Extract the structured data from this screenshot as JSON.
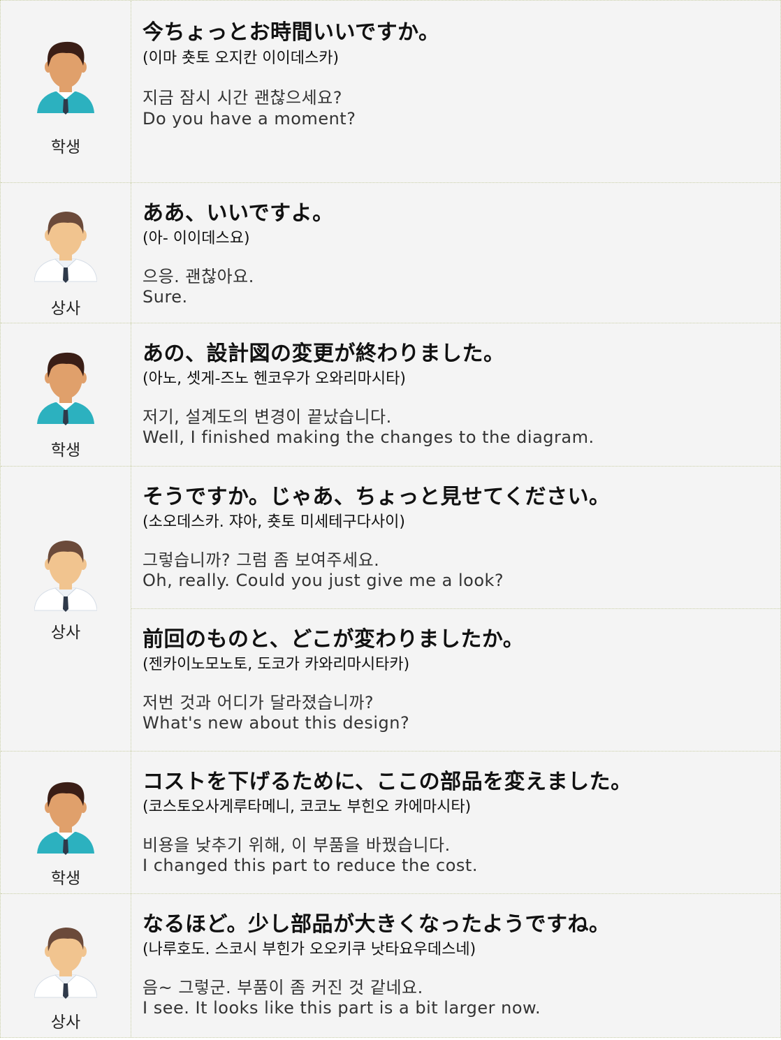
{
  "colors": {
    "background": "#f4f4f4",
    "border": "#c9cfa6",
    "student_shirt": "#2cb1bf",
    "boss_shirt": "#ffffff",
    "skin_student": "#e0a06b",
    "skin_boss": "#f1c48f"
  },
  "rows": [
    {
      "speaker": {
        "role": "학생",
        "icon": "student-avatar-icon"
      },
      "lines": [
        {
          "jp": "今ちょっとお時間いいですか。",
          "reading": "(이마 춋토 오지칸 이이데스카)",
          "ko": "지금 잠시 시간 괜찮으세요?",
          "en": "Do you have a moment?"
        }
      ]
    },
    {
      "speaker": {
        "role": "상사",
        "icon": "boss-avatar-icon"
      },
      "lines": [
        {
          "jp": "ああ、いいですよ。",
          "reading": "(아- 이이데스요)",
          "ko": "으응. 괜찮아요.",
          "en": "Sure."
        }
      ]
    },
    {
      "speaker": {
        "role": "학생",
        "icon": "student-avatar-icon"
      },
      "lines": [
        {
          "jp": "あの、設計図の変更が終わりました。",
          "reading": "(아노, 셋게-즈노 헨코우가 오와리마시타)",
          "ko": "저기, 설계도의 변경이 끝났습니다.",
          "en": "Well, I finished making the changes to the diagram."
        }
      ]
    },
    {
      "speaker": {
        "role": "상사",
        "icon": "boss-avatar-icon"
      },
      "lines": [
        {
          "jp": "そうですか。じゃあ、ちょっと見せてください。",
          "reading": "(소오데스카. 쟈아, 춋토 미세테구다사이)",
          "ko": "그렇습니까? 그럼 좀 보여주세요.",
          "en": "Oh, really. Could you just give me a look?"
        },
        {
          "jp": "前回のものと、どこが変わりましたか。",
          "reading": "(젠카이노모노토, 도코가 카와리마시타카)",
          "ko": "저번 것과 어디가 달라졌습니까?",
          "en": "What's new about this design?"
        }
      ]
    },
    {
      "speaker": {
        "role": "학생",
        "icon": "student-avatar-icon"
      },
      "lines": [
        {
          "jp": "コストを下げるために、ここの部品を変えました。",
          "reading": "(코스토오사게루타메니, 코코노 부힌오 카에마시타)",
          "ko": "비용을 낮추기 위해, 이 부품을 바꿨습니다.",
          "en": "I changed this part to reduce the cost."
        }
      ]
    },
    {
      "speaker": {
        "role": "상사",
        "icon": "boss-avatar-icon"
      },
      "lines": [
        {
          "jp": "なるほど。少し部品が大きくなったようですね。",
          "reading": " (나루호도. 스코시 부힌가 오오키쿠 낫타요우데스네)",
          "ko": "음~ 그렇군. 부품이 좀 커진 것 같네요.",
          "en": "I see. It looks like this part is a bit larger now."
        }
      ]
    }
  ]
}
